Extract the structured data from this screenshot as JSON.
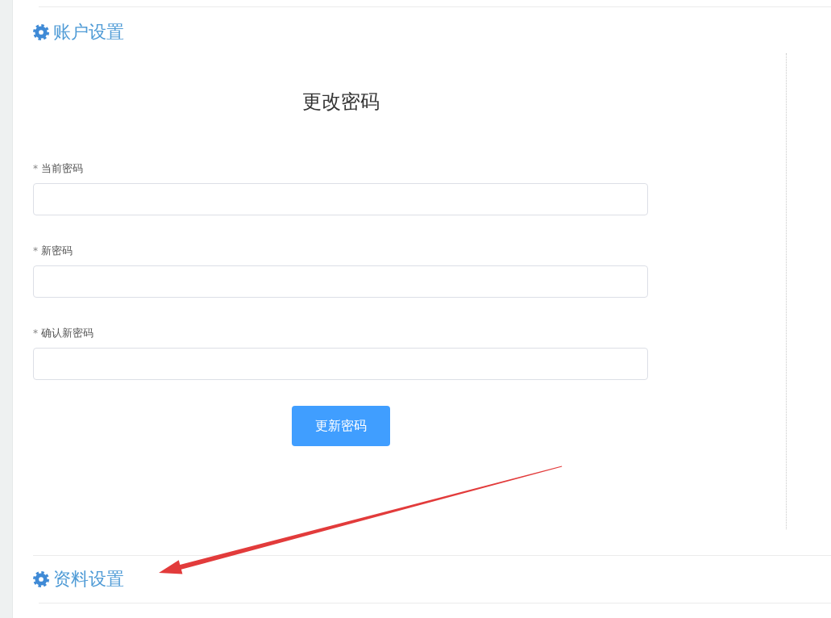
{
  "account_settings": {
    "title": "账户设置",
    "form": {
      "title": "更改密码",
      "fields": [
        {
          "required_mark": "*",
          "label": "当前密码"
        },
        {
          "required_mark": "*",
          "label": "新密码"
        },
        {
          "required_mark": "*",
          "label": "确认新密码"
        }
      ],
      "submit": "更新密码"
    }
  },
  "profile_settings": {
    "title": "资料设置"
  }
}
